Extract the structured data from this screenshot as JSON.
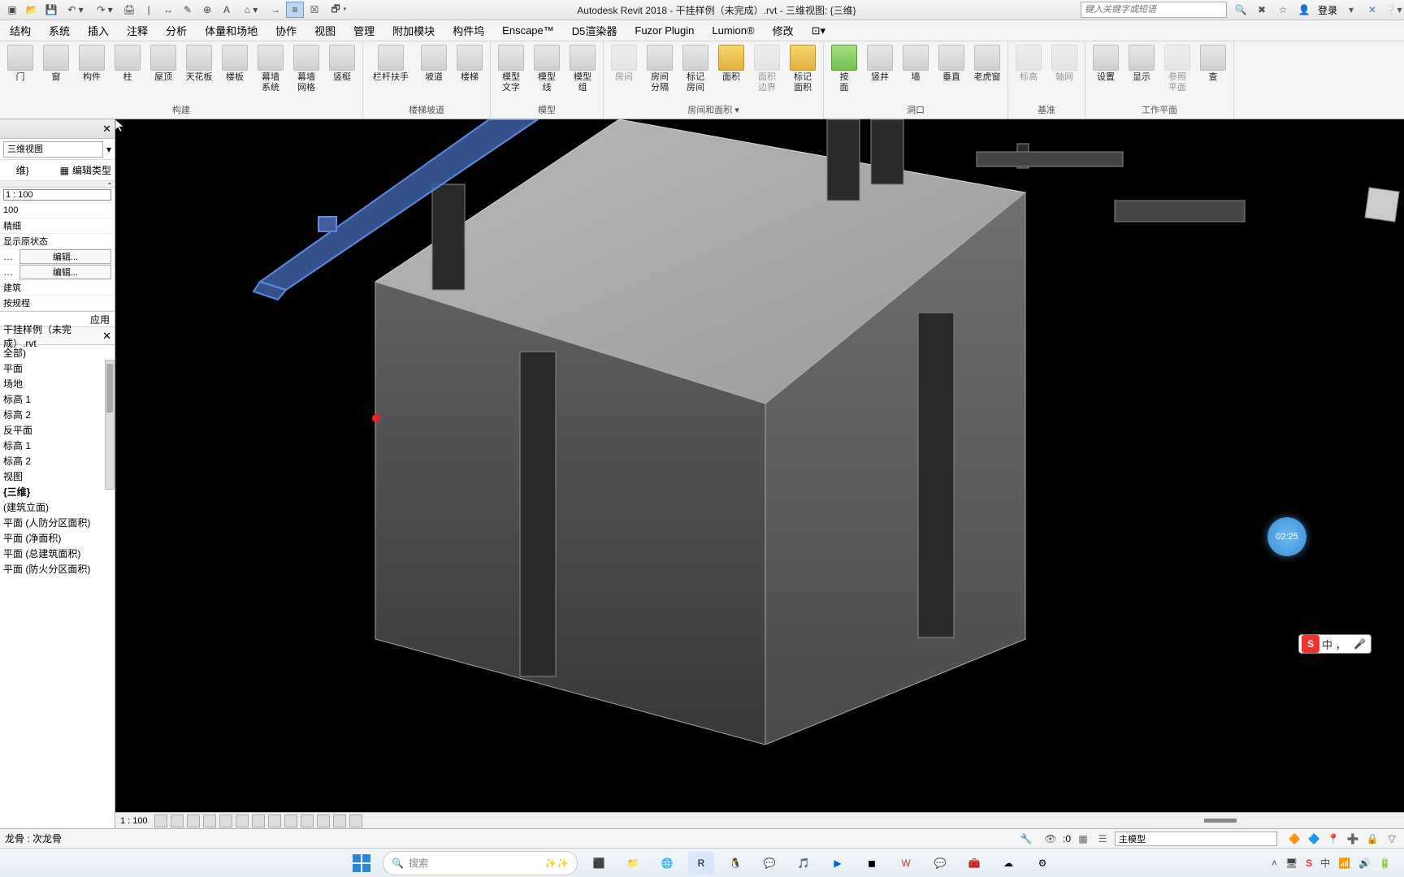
{
  "titlebar": {
    "title": "Autodesk Revit 2018 -    干挂样例（未完成）.rvt - 三维视图: {三维}",
    "search_placeholder": "键入关键字或短语",
    "login": "登录"
  },
  "menu": [
    "结构",
    "系统",
    "插入",
    "注释",
    "分析",
    "体量和场地",
    "协作",
    "视图",
    "管理",
    "附加模块",
    "构件坞",
    "Enscape™",
    "D5渲染器",
    "Fuzor Plugin",
    "Lumion®",
    "修改"
  ],
  "ribbon": {
    "panels": [
      {
        "title": "构建",
        "buttons": [
          {
            "label": "门"
          },
          {
            "label": "窗"
          },
          {
            "label": "构件"
          },
          {
            "label": "柱"
          },
          {
            "label": "屋顶"
          },
          {
            "label": "天花板"
          },
          {
            "label": "楼板"
          },
          {
            "label": "幕墙\n系统"
          },
          {
            "label": "幕墙\n网格"
          },
          {
            "label": "竖梃"
          }
        ]
      },
      {
        "title": "楼梯坡道",
        "buttons": [
          {
            "label": "栏杆扶手",
            "wide": true
          },
          {
            "label": "坡道"
          },
          {
            "label": "楼梯"
          }
        ]
      },
      {
        "title": "模型",
        "buttons": [
          {
            "label": "模型\n文字"
          },
          {
            "label": "模型\n线"
          },
          {
            "label": "模型\n组"
          }
        ]
      },
      {
        "title": "房间和面积 ▾",
        "buttons": [
          {
            "label": "房间",
            "dim": true
          },
          {
            "label": "房间\n分隔"
          },
          {
            "label": "标记\n房间"
          },
          {
            "label": "面积",
            "gold": true
          },
          {
            "label": "面积\n边界",
            "dim": true
          },
          {
            "label": "标记\n面积",
            "gold": true
          }
        ]
      },
      {
        "title": "洞口",
        "buttons": [
          {
            "label": "按\n面",
            "green": true
          },
          {
            "label": "竖井"
          },
          {
            "label": "墙"
          },
          {
            "label": "垂直"
          },
          {
            "label": "老虎窗"
          }
        ]
      },
      {
        "title": "基准",
        "buttons": [
          {
            "label": "标高",
            "dim": true
          },
          {
            "label": "轴网",
            "dim": true
          }
        ]
      },
      {
        "title": "工作平面",
        "buttons": [
          {
            "label": "设置"
          },
          {
            "label": "显示"
          },
          {
            "label": "参照\n平面",
            "dim": true
          },
          {
            "label": "查"
          }
        ]
      }
    ]
  },
  "props": {
    "header": "",
    "type_dd": "三维视图",
    "instance_dd": "维}",
    "edit_type": "编辑类型",
    "rows": [
      {
        "val": "1 : 100",
        "input": true
      },
      {
        "val": "100"
      },
      {
        "val": "精细"
      },
      {
        "val": "显示原状态"
      },
      {
        "btn": "编辑..."
      },
      {
        "btn": "编辑..."
      },
      {
        "val": "建筑"
      },
      {
        "val": "按规程"
      }
    ],
    "apply": "应用"
  },
  "browser": {
    "tab": "干挂样例（未完成）.rvt",
    "items": [
      {
        "t": "全部)"
      },
      {
        "t": "平面"
      },
      {
        "t": "场地"
      },
      {
        "t": "标高 1"
      },
      {
        "t": "标高 2"
      },
      {
        "t": "反平面"
      },
      {
        "t": "标高 1"
      },
      {
        "t": "标高 2"
      },
      {
        "t": "视图"
      },
      {
        "t": "{三维}",
        "bold": true
      },
      {
        "t": "(建筑立面)"
      },
      {
        "t": "平面 (人防分区面积)"
      },
      {
        "t": "平面 (净面积)"
      },
      {
        "t": "平面 (总建筑面积)"
      },
      {
        "t": "平面 (防火分区面积)"
      }
    ]
  },
  "viewctrl": {
    "scale": "1 : 100"
  },
  "status": {
    "left": "龙骨 : 次龙骨",
    "count": ":0",
    "model": "主模型"
  },
  "timer": "02:25",
  "taskbar": {
    "search": "搜索",
    "time": "",
    "ime_zh": "中"
  },
  "ime": {
    "s": "S",
    "zh": "中 ，"
  }
}
